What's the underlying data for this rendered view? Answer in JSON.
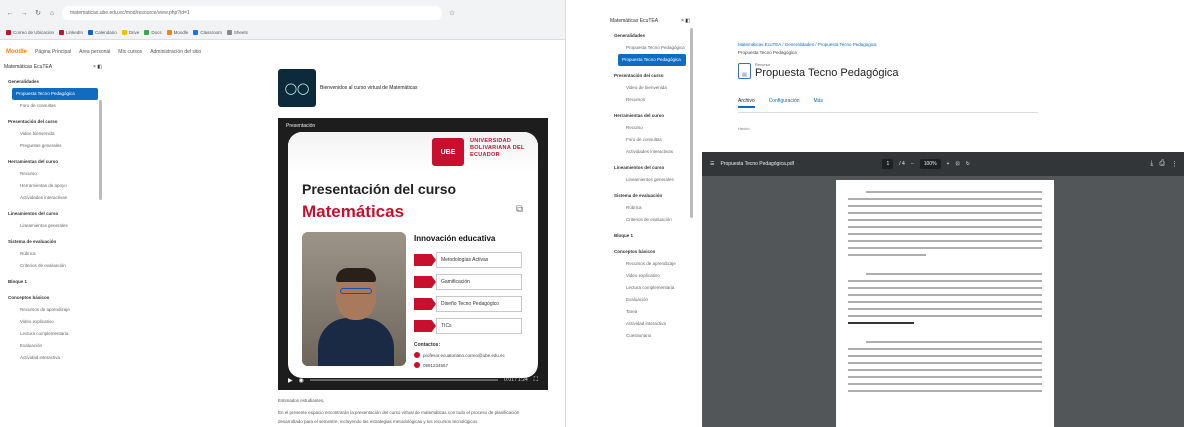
{
  "left": {
    "url": "matematicas.ube.edu.ec/mod/resource/view.php?id=1",
    "bookmarks": [
      {
        "label": "Correo de Ubicacion",
        "color": "#c8102e"
      },
      {
        "label": "LinkedIn",
        "color": "#c8102e"
      },
      {
        "label": "Calendario",
        "color": "#0a66c2"
      },
      {
        "label": "Drive",
        "color": "#fbbc04"
      },
      {
        "label": "Docs",
        "color": "#34a853"
      },
      {
        "label": "Moodle",
        "color": "#f98012"
      },
      {
        "label": "Classroom",
        "color": "#1a73e8"
      },
      {
        "label": "Sheets",
        "color": "#888"
      }
    ],
    "moodle_nav": [
      "Moodle",
      "Página Principal",
      "Área personal",
      "Mis cursos",
      "Administración del sitio"
    ],
    "sidebar": {
      "title": "Matemáticas EcuTEA",
      "items": [
        {
          "label": "Generalidades",
          "kind": "sec"
        },
        {
          "label": "Propuesta Tecno Pedagógica",
          "kind": "active"
        },
        {
          "label": "Foro de consultas",
          "kind": "sub"
        },
        {
          "label": "Presentación del curso",
          "kind": "sec"
        },
        {
          "label": "Video bienvenida",
          "kind": "sub"
        },
        {
          "label": "Preguntas generales",
          "kind": "sub"
        },
        {
          "label": "Herramientas del curso",
          "kind": "sec"
        },
        {
          "label": "Recurso",
          "kind": "sub"
        },
        {
          "label": "Herramientas de apoyo",
          "kind": "sub"
        },
        {
          "label": "Actividades interactivas",
          "kind": "sub"
        },
        {
          "label": "Lineamientos del curso",
          "kind": "sec"
        },
        {
          "label": "Lineamientos generales",
          "kind": "sub"
        },
        {
          "label": "Sistema de evaluación",
          "kind": "sec"
        },
        {
          "label": "Rúbrica",
          "kind": "sub"
        },
        {
          "label": "Criterios de evaluación",
          "kind": "sub"
        },
        {
          "label": "Bloque 1",
          "kind": "sec"
        },
        {
          "label": "Conceptos básicos",
          "kind": "sec"
        },
        {
          "label": "Recursos de aprendizaje",
          "kind": "sub"
        },
        {
          "label": "Video explicativo",
          "kind": "sub"
        },
        {
          "label": "Lectura complementaria",
          "kind": "sub"
        },
        {
          "label": "Evaluación",
          "kind": "sub"
        },
        {
          "label": "Actividad interactiva",
          "kind": "sub"
        }
      ]
    },
    "course_title": "Bienvenidos al curso virtual de Matemáticas",
    "video": {
      "top_label": "Presentación",
      "university": "UNIVERSIDAD BOLIVARIANA DEL ECUADOR",
      "university_short": "UBE",
      "title1": "Presentación del curso",
      "title2": "Matemáticas",
      "innovation_title": "Innovación educativa",
      "features": [
        "Metodologías Activas",
        "Gamificación",
        "Diseño Tecno Pedagógico",
        "TICs"
      ],
      "contact_heading": "Contactos:",
      "contacts": [
        "profesor.ecuatoriano.correo@ube.edu.ec",
        "0991234567"
      ],
      "time": "0:01 / 1:24"
    },
    "below_lines": [
      "Estimados estudiantes,",
      "En el presente espacio encontrarán la presentación del curso virtual de matemáticas con todo el proceso de planificación",
      "desarrollado para el semestre, incluyendo las estrategias metodológicas y los recursos tecnológicos"
    ]
  },
  "right": {
    "sidebar": {
      "title": "Matemáticas EcuTEA",
      "items": [
        {
          "label": "Generalidades",
          "kind": "sec"
        },
        {
          "label": "Propuesta Tecno Pedagógica",
          "kind": "sub"
        },
        {
          "label": "Propuesta Tecno Pedagógica",
          "kind": "active"
        },
        {
          "label": "Presentación del curso",
          "kind": "sec"
        },
        {
          "label": "Video de bienvenida",
          "kind": "sub"
        },
        {
          "label": "Recursos",
          "kind": "sub"
        },
        {
          "label": "Herramientas del curso",
          "kind": "sec"
        },
        {
          "label": "Recurso",
          "kind": "sub"
        },
        {
          "label": "Foro de consultas",
          "kind": "sub"
        },
        {
          "label": "Actividades interactivas",
          "kind": "sub"
        },
        {
          "label": "Lineamientos del curso",
          "kind": "sec"
        },
        {
          "label": "Lineamientos generales",
          "kind": "sub"
        },
        {
          "label": "Sistema de evaluación",
          "kind": "sec"
        },
        {
          "label": "Rúbrica",
          "kind": "sub"
        },
        {
          "label": "Criterios de evaluación",
          "kind": "sub"
        },
        {
          "label": "Bloque 1",
          "kind": "sec"
        },
        {
          "label": "Conceptos básicos",
          "kind": "sec"
        },
        {
          "label": "Recursos de aprendizaje",
          "kind": "sub"
        },
        {
          "label": "Video explicativo",
          "kind": "sub"
        },
        {
          "label": "Lectura complementaria",
          "kind": "sub"
        },
        {
          "label": "Evaluación",
          "kind": "sub"
        },
        {
          "label": "Tarea",
          "kind": "sub"
        },
        {
          "label": "Actividad interactiva",
          "kind": "sub"
        },
        {
          "label": "Cuestionario",
          "kind": "sub"
        }
      ]
    },
    "breadcrumb": "Matemáticas EcuTEA / Generalidades / Propuesta Tecno Pedagógica",
    "breadcrumb2": "Propuesta Tecno Pedagógica",
    "resource_type": "Recurso",
    "title": "Propuesta Tecno Pedagógica",
    "tabs": [
      "Archivo",
      "Configuración",
      "Más"
    ],
    "small_text": "Hecho",
    "pdf": {
      "filename": "Propuesta Tecno Pedagógica.pdf",
      "page": "1",
      "pages": "/ 4",
      "zoom": "100%"
    }
  }
}
